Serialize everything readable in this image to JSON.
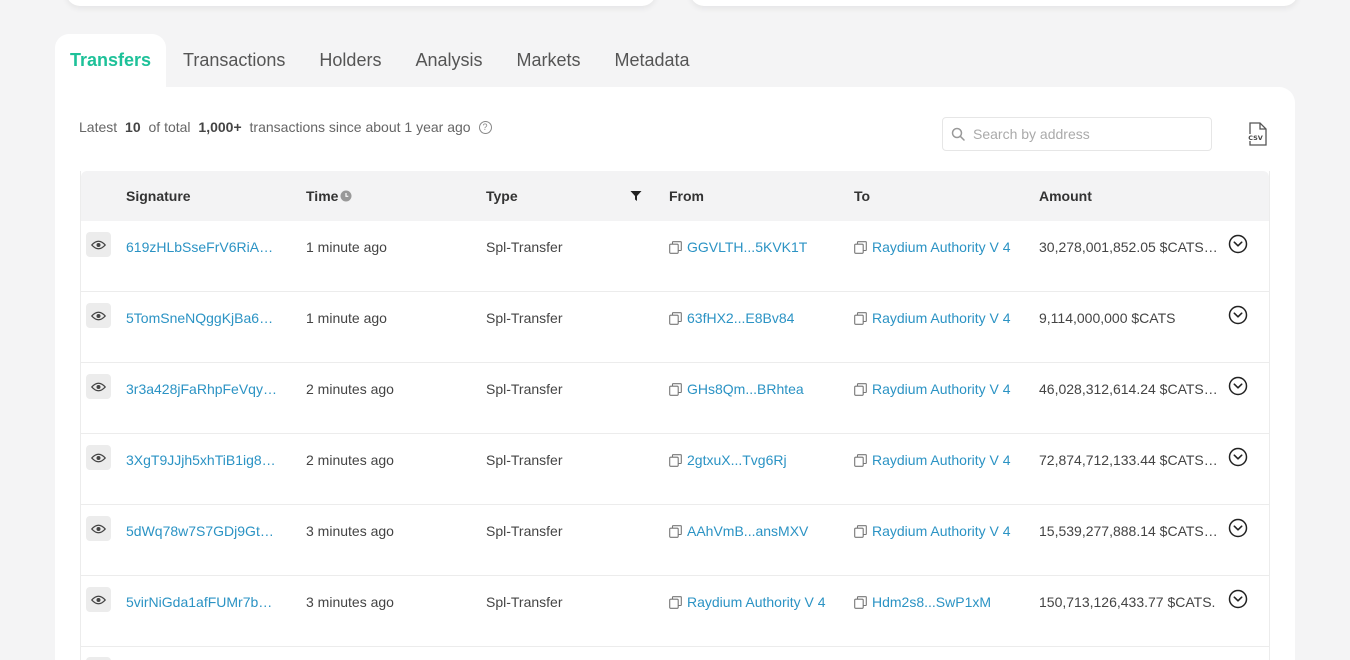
{
  "tabs": [
    "Transfers",
    "Transactions",
    "Holders",
    "Analysis",
    "Markets",
    "Metadata"
  ],
  "summary": {
    "prefix": "Latest ",
    "count": "10",
    "middle": " of total ",
    "total": "1,000+",
    "suffix": " transactions since about 1 year ago"
  },
  "search": {
    "placeholder": "Search by address"
  },
  "columns": {
    "signature": "Signature",
    "time": "Time",
    "type": "Type",
    "from": "From",
    "to": "To",
    "amount": "Amount"
  },
  "icons": {
    "view": "eye-icon",
    "copy": "copy-icon",
    "expand": "chevron-down-circle-icon",
    "help": "question-circle-icon",
    "clock": "clock-icon",
    "filter": "filter-icon",
    "search": "search-icon",
    "export": "csv-export-icon"
  },
  "accent_color": "#1ec199",
  "link_color": "#2b93c4",
  "rows": [
    {
      "signature": "619zHLbSseFrV6RiAd…",
      "time": "1 minute ago",
      "type": "Spl-Transfer",
      "from": "GGVLTH...5KVK1T",
      "to": "Raydium Authority V 4",
      "amount": "30,278,001,852.05  $CATS…"
    },
    {
      "signature": "5TomSneNQggKjBa6…",
      "time": "1 minute ago",
      "type": "Spl-Transfer",
      "from": "63fHX2...E8Bv84",
      "to": "Raydium Authority V 4",
      "amount": "9,114,000,000  $CATS"
    },
    {
      "signature": "3r3a428jFaRhpFeVqy…",
      "time": "2 minutes ago",
      "type": "Spl-Transfer",
      "from": "GHs8Qm...BRhtea",
      "to": "Raydium Authority V 4",
      "amount": "46,028,312,614.24  $CATS…"
    },
    {
      "signature": "3XgT9JJjh5xhTiB1ig8…",
      "time": "2 minutes ago",
      "type": "Spl-Transfer",
      "from": "2gtxuX...Tvg6Rj",
      "to": "Raydium Authority V 4",
      "amount": "72,874,712,133.44  $CATS…"
    },
    {
      "signature": "5dWq78w7S7GDj9Gt…",
      "time": "3 minutes ago",
      "type": "Spl-Transfer",
      "from": "AAhVmB...ansMXV",
      "to": "Raydium Authority V 4",
      "amount": "15,539,277,888.14  $CATS…"
    },
    {
      "signature": "5virNiGda1afFUMr7b…",
      "time": "3 minutes ago",
      "type": "Spl-Transfer",
      "from": "Raydium Authority V 4",
      "to": "Hdm2s8...SwP1xM",
      "amount": "150,713,126,433.77  $CATS."
    }
  ]
}
